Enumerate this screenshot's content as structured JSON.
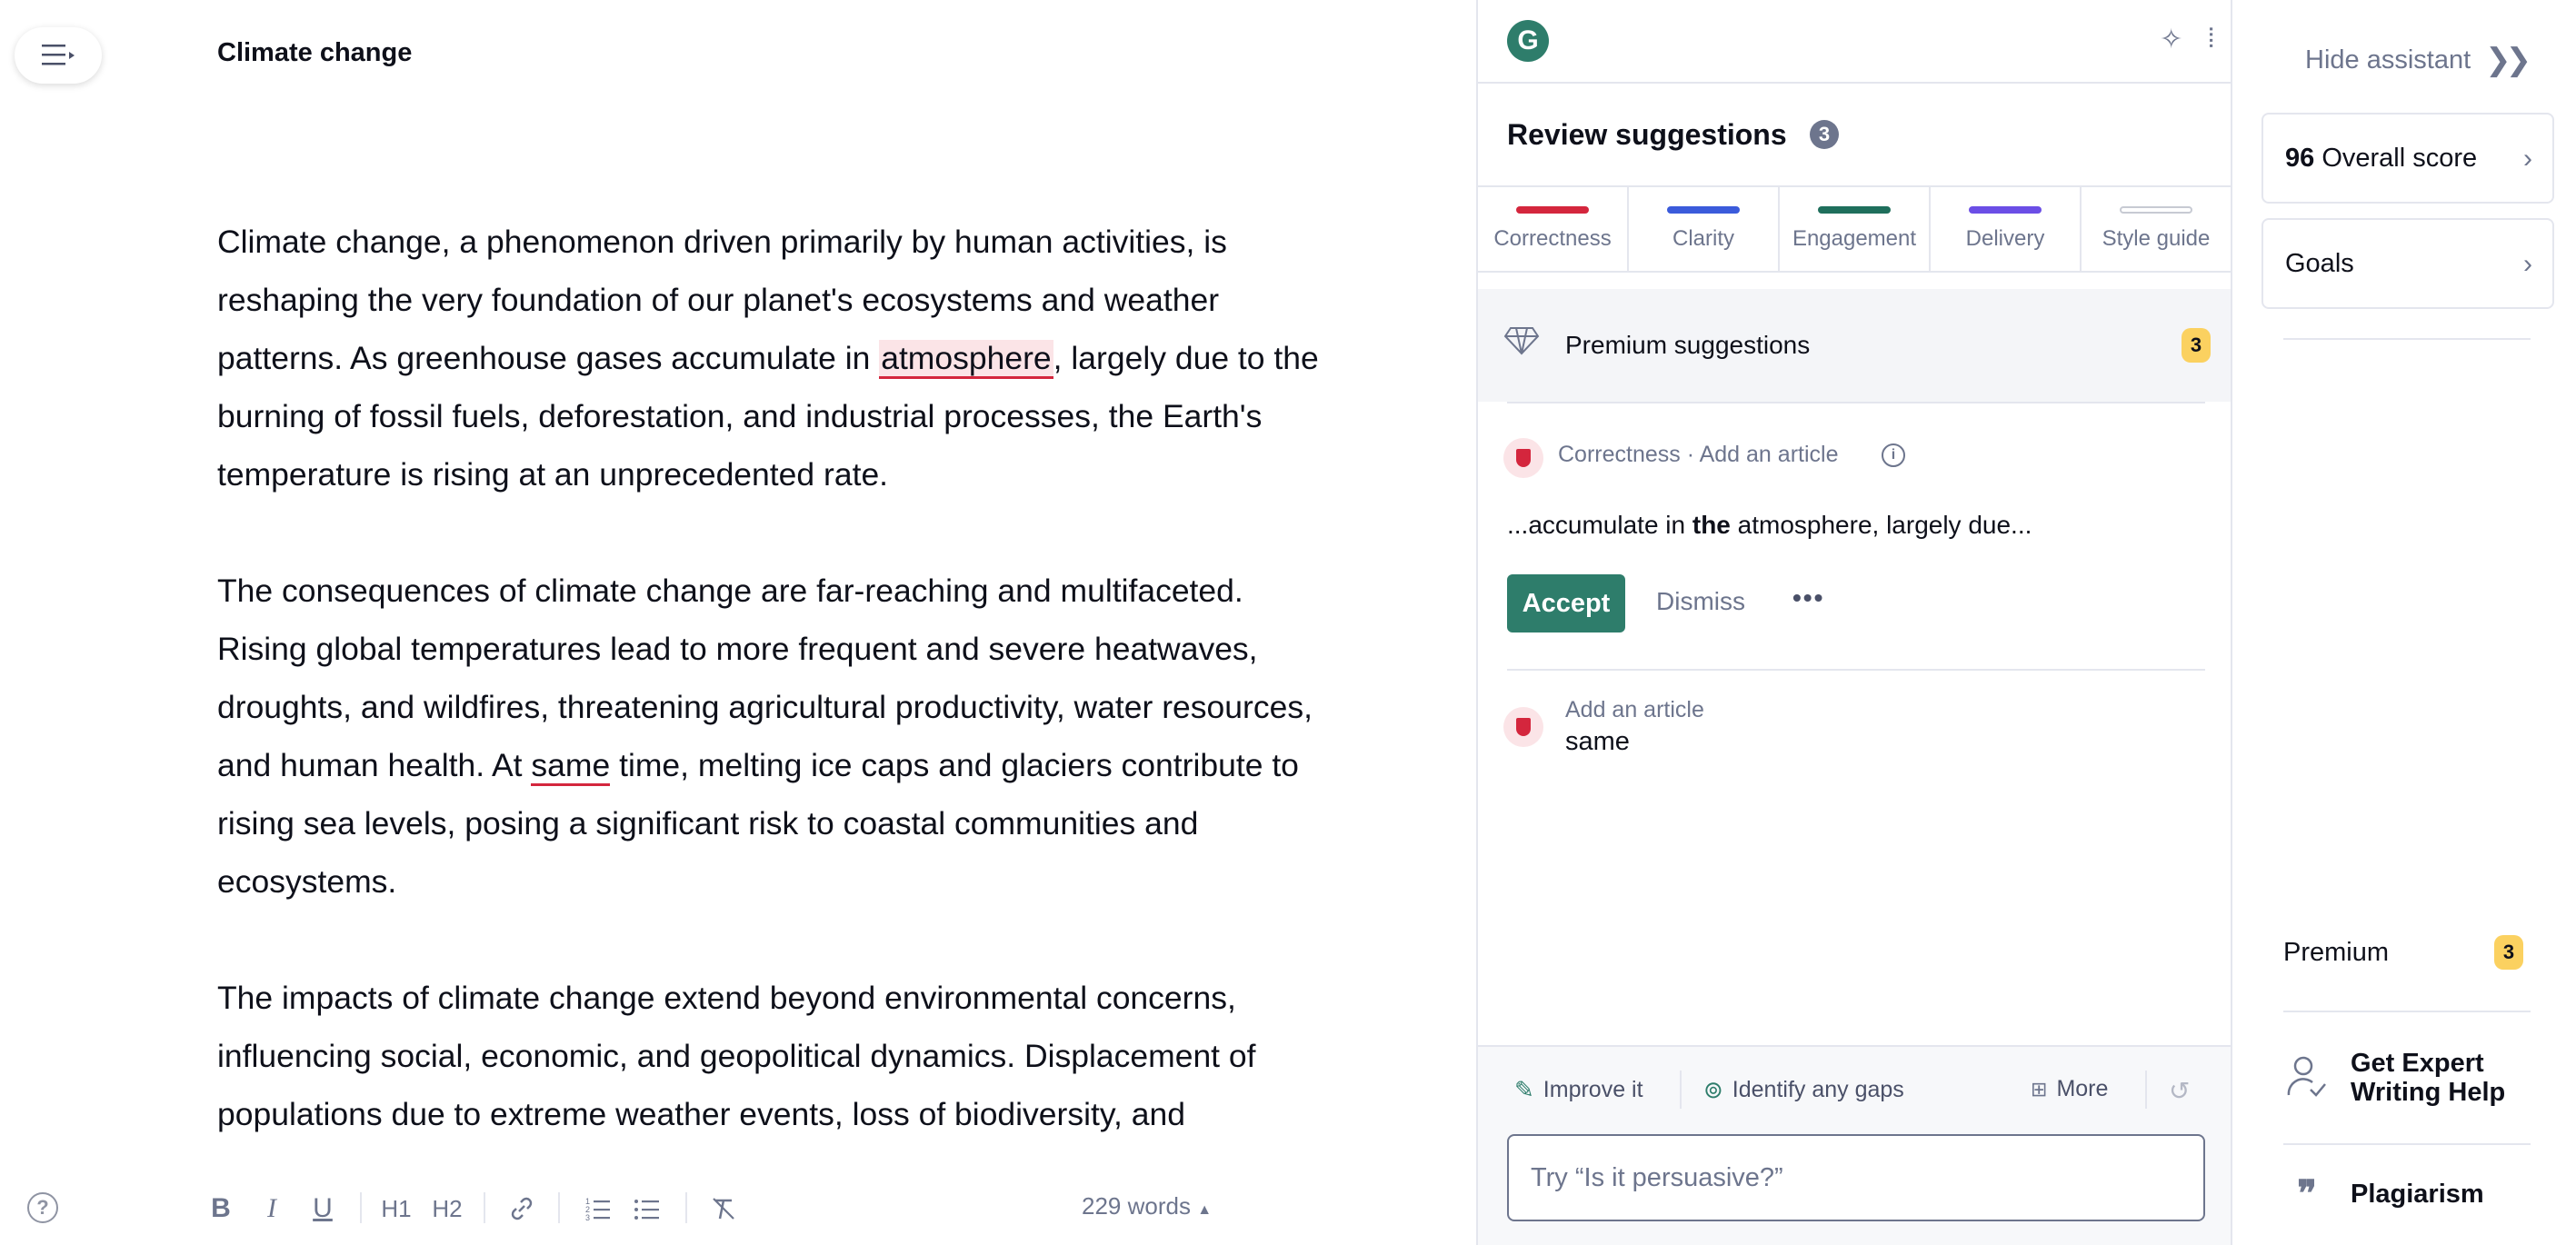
{
  "editor": {
    "title": "Climate change",
    "paragraphs": {
      "p1_a": "Climate change, a phenomenon driven primarily by human activities, is reshaping the very foundation of our planet's ecosystems and weather patterns. As greenhouse gases accumulate in ",
      "p1_hl": "atmosphere",
      "p1_b": ", largely due to the burning of fossil fuels, deforestation, and industrial processes, the Earth's temperature is rising at an unprecedented rate.",
      "p2_a": "The consequences of climate change are far-reaching and multifaceted. Rising global temperatures lead to more frequent and severe heatwaves, droughts, and wildfires, threatening agricultural productivity, water resources, and human health. At ",
      "p2_hl": "same",
      "p2_b": " time, melting ice caps and glaciers contribute to rising sea levels, posing a significant risk to coastal communities and ecosystems.",
      "p3": "The impacts of climate change extend beyond environmental concerns, influencing social, economic, and geopolitical dynamics. Displacement of populations due to extreme weather events, loss of biodiversity, and"
    },
    "toolbar": {
      "bold": "B",
      "italic": "I",
      "underline": "U",
      "h1": "H1",
      "h2": "H2",
      "word_count": "229 words"
    },
    "help_glyph": "?"
  },
  "assistant": {
    "logo_letter": "G",
    "review_title": "Review suggestions",
    "review_count": "3",
    "tabs": [
      {
        "label": "Correctness",
        "color": "#d4263d"
      },
      {
        "label": "Clarity",
        "color": "#3b5bdb"
      },
      {
        "label": "Engagement",
        "color": "#1f6f5c"
      },
      {
        "label": "Delivery",
        "color": "#6b4ee6"
      },
      {
        "label": "Style guide",
        "color": "#c7cad3"
      }
    ],
    "premium": {
      "label": "Premium suggestions",
      "count": "3"
    },
    "card": {
      "category": "Correctness · Add an article",
      "snippet_before": "...accumulate in ",
      "snippet_bold": "the",
      "snippet_after": " atmosphere, largely due...",
      "accept": "Accept",
      "dismiss": "Dismiss",
      "more": "•••"
    },
    "card2": {
      "category": "Add an article",
      "word": "same"
    },
    "chips": {
      "improve": "Improve it",
      "gaps": "Identify any gaps",
      "more": "More"
    },
    "prompt_placeholder": "Try “Is it persuasive?”",
    "accent": "#2e7d6b"
  },
  "rail": {
    "hide_label": "Hide assistant",
    "score_value": "96",
    "score_label": "Overall score",
    "goals": "Goals",
    "premium": "Premium",
    "premium_count": "3",
    "expert": "Get Expert Writing Help",
    "plagiarism": "Plagiarism"
  }
}
